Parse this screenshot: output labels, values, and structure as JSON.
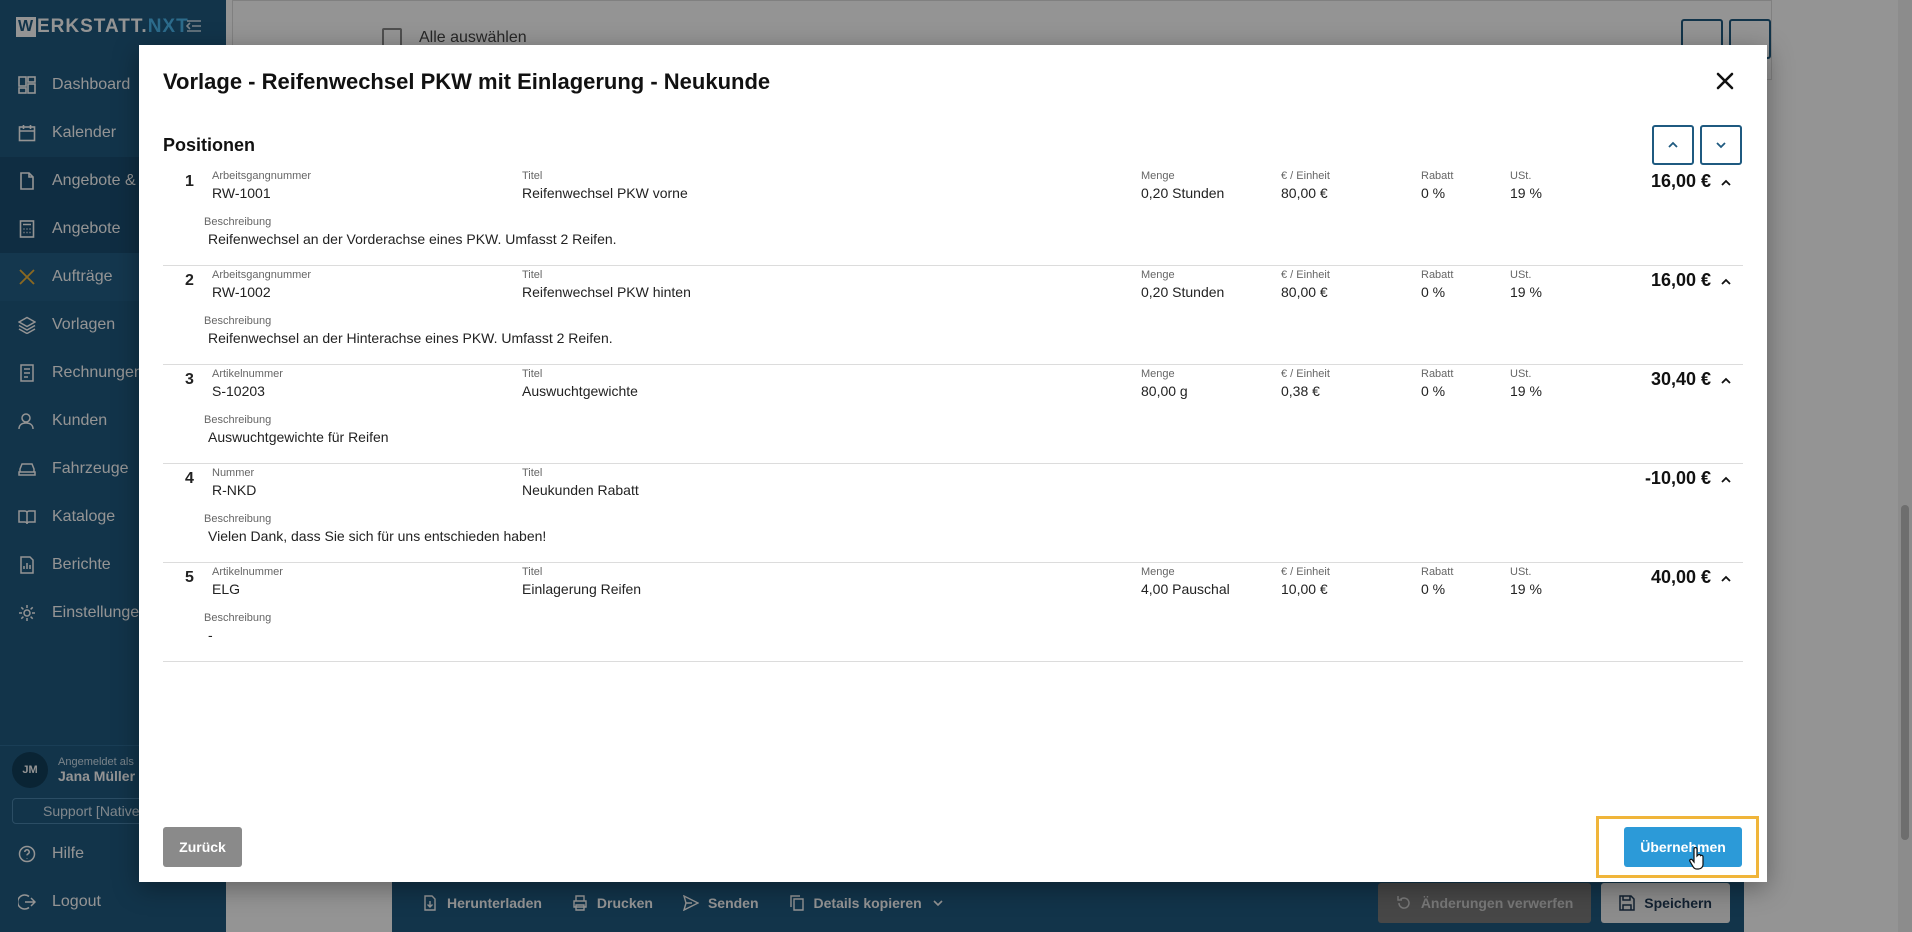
{
  "app": {
    "logo_w": "W",
    "logo_main": "ERKSTATT.",
    "logo_nxt": "NXT"
  },
  "sidebar": {
    "items": [
      {
        "label": "Dashboard",
        "icon": "dashboard-icon"
      },
      {
        "label": "Kalender",
        "icon": "calendar-icon"
      },
      {
        "label": "Angebote &",
        "icon": "document-icon"
      },
      {
        "label": "Angebote",
        "icon": "calculator-icon"
      },
      {
        "label": "Aufträge",
        "icon": "tools-icon"
      },
      {
        "label": "Vorlagen",
        "icon": "layers-icon"
      },
      {
        "label": "Rechnungen",
        "icon": "invoice-icon"
      },
      {
        "label": "Kunden",
        "icon": "customers-icon"
      },
      {
        "label": "Fahrzeuge",
        "icon": "car-icon"
      },
      {
        "label": "Kataloge",
        "icon": "book-icon"
      },
      {
        "label": "Berichte",
        "icon": "report-icon"
      },
      {
        "label": "Einstellungen",
        "icon": "gear-icon"
      }
    ],
    "user": {
      "initials": "JM",
      "logged_in_label": "Angemeldet als",
      "name": "Jana Müller"
    },
    "support": "Support [Native]",
    "help": "Hilfe",
    "logout": "Logout"
  },
  "background": {
    "select_all": "Alle auswählen",
    "bottom_bar": {
      "download": "Herunterladen",
      "print": "Drucken",
      "send": "Senden",
      "copy_details": "Details kopieren",
      "discard": "Änderungen verwerfen",
      "save": "Speichern"
    }
  },
  "modal": {
    "title": "Vorlage - Reifenwechsel PKW mit Einlagerung - Neukunde",
    "section": "Positionen",
    "labels": {
      "title": "Titel",
      "quantity": "Menge",
      "unit_price": "€ / Einheit",
      "discount": "Rabatt",
      "vat": "USt.",
      "description": "Beschreibung"
    },
    "positions": [
      {
        "no": "1",
        "id_label": "Arbeitsgangnummer",
        "id": "RW-1001",
        "title": "Reifenwechsel PKW vorne",
        "quantity": "0,20 Stunden",
        "unit_price": "80,00 €",
        "discount": "0 %",
        "vat": "19 %",
        "total": "16,00 €",
        "description": "Reifenwechsel an der Vorderachse eines PKW. Umfasst 2 Reifen."
      },
      {
        "no": "2",
        "id_label": "Arbeitsgangnummer",
        "id": "RW-1002",
        "title": "Reifenwechsel PKW hinten",
        "quantity": "0,20 Stunden",
        "unit_price": "80,00 €",
        "discount": "0 %",
        "vat": "19 %",
        "total": "16,00 €",
        "description": "Reifenwechsel an der Hinterachse eines PKW. Umfasst 2 Reifen."
      },
      {
        "no": "3",
        "id_label": "Artikelnummer",
        "id": "S-10203",
        "title": "Auswuchtgewichte",
        "quantity": "80,00 g",
        "unit_price": "0,38 €",
        "discount": "0 %",
        "vat": "19 %",
        "total": "30,40 €",
        "description": "Auswuchtgewichte für Reifen"
      },
      {
        "no": "4",
        "id_label": "Nummer",
        "id": "R-NKD",
        "title": "Neukunden Rabatt",
        "total": "-10,00 €",
        "description": "Vielen Dank, dass Sie sich für uns entschieden haben!"
      },
      {
        "no": "5",
        "id_label": "Artikelnummer",
        "id": "ELG",
        "title": "Einlagerung Reifen",
        "quantity": "4,00 Pauschal",
        "unit_price": "10,00 €",
        "discount": "0 %",
        "vat": "19 %",
        "total": "40,00 €",
        "description": "-"
      }
    ],
    "back_button": "Zurück",
    "apply_button": "Übernehmen"
  },
  "colors": {
    "sidebar": "#1f5a80",
    "accent": "#2c9ad8",
    "focus": "#f0b53a",
    "back_button": "#8a8a8a"
  }
}
